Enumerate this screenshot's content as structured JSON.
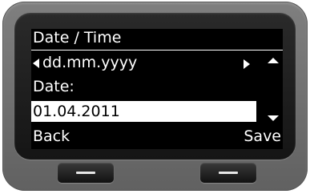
{
  "screen": {
    "title": "Date / Time",
    "format_value": "dd.mm.yyyy",
    "field_label": "Date:",
    "date_value": "01.04.2011"
  },
  "softkeys": {
    "left_label": "Back",
    "right_label": "Save"
  },
  "icons": {
    "format_prev": "left-arrow-icon",
    "format_next": "right-arrow-icon",
    "scroll_up": "scroll-up-icon",
    "scroll_down": "scroll-down-icon",
    "softkey_bar": "minus-bar-icon"
  },
  "colors": {
    "screen_background": "#000000",
    "screen_text": "#ffffff",
    "selected_field_background": "#ffffff",
    "device_body": "#737373"
  }
}
